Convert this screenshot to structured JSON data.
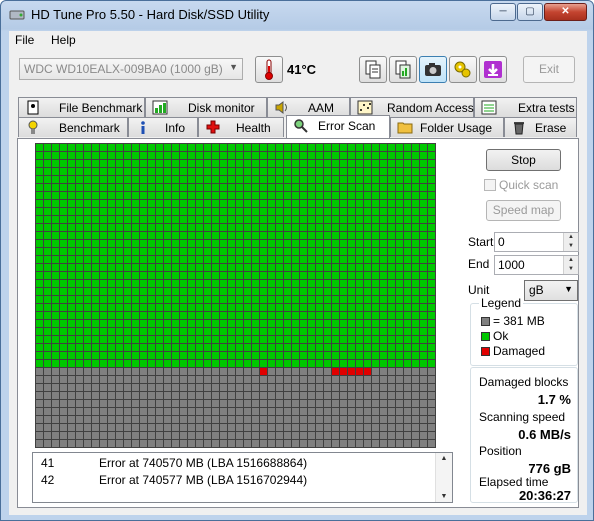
{
  "window": {
    "title": "HD Tune Pro 5.50 - Hard Disk/SSD Utility",
    "controls": {
      "minimize": "─",
      "maximize": "▢",
      "close": "✕"
    }
  },
  "menu": {
    "file": "File",
    "help": "Help"
  },
  "toolbar": {
    "drive": "WDC WD10EALX-009BA0 (1000 gB)",
    "temperature": "41°C",
    "exit_label": "Exit"
  },
  "tabs_top": [
    {
      "label": "File Benchmark",
      "icon": "file-benchmark-icon"
    },
    {
      "label": "Disk monitor",
      "icon": "disk-monitor-icon"
    },
    {
      "label": "AAM",
      "icon": "speaker-icon"
    },
    {
      "label": "Random Access",
      "icon": "random-access-icon"
    },
    {
      "label": "Extra tests",
      "icon": "extra-tests-icon"
    }
  ],
  "tabs_bottom": [
    {
      "label": "Benchmark",
      "icon": "benchmark-icon"
    },
    {
      "label": "Info",
      "icon": "info-icon"
    },
    {
      "label": "Health",
      "icon": "health-cross-icon"
    },
    {
      "label": "Error Scan",
      "icon": "magnifier-icon",
      "selected": true
    },
    {
      "label": "Folder Usage",
      "icon": "folder-icon"
    },
    {
      "label": "Erase",
      "icon": "trash-icon"
    }
  ],
  "scan": {
    "columns": 50,
    "rows": 38,
    "ok_rows": 28,
    "damaged_cells": [
      [
        28,
        28
      ],
      [
        28,
        37
      ],
      [
        28,
        38
      ],
      [
        28,
        39
      ],
      [
        28,
        40
      ],
      [
        28,
        41
      ]
    ],
    "colors": {
      "ok": "#00c800",
      "untested": "#808080",
      "damaged": "#e00000",
      "grid": "#404040"
    }
  },
  "controls": {
    "stop_label": "Stop",
    "quick_scan_label": "Quick scan",
    "speed_map_label": "Speed map",
    "start_label": "Start",
    "start_value": "0",
    "end_label": "End",
    "end_value": "1000",
    "unit_label": "Unit",
    "unit_value": "gB"
  },
  "legend": {
    "title": "Legend",
    "block_size": "= 381 MB",
    "ok": "Ok",
    "damaged": "Damaged"
  },
  "stats": {
    "damaged_blocks_label": "Damaged blocks",
    "damaged_blocks_value": "1.7 %",
    "scanning_speed_label": "Scanning speed",
    "scanning_speed_value": "0.6 MB/s",
    "position_label": "Position",
    "position_value": "776 gB",
    "elapsed_label": "Elapsed time",
    "elapsed_value": "20:36:27"
  },
  "log": [
    {
      "num": "41",
      "msg": "Error at 740570 MB (LBA 1516688864)"
    },
    {
      "num": "42",
      "msg": "Error at 740577 MB (LBA 1516702944)"
    }
  ]
}
